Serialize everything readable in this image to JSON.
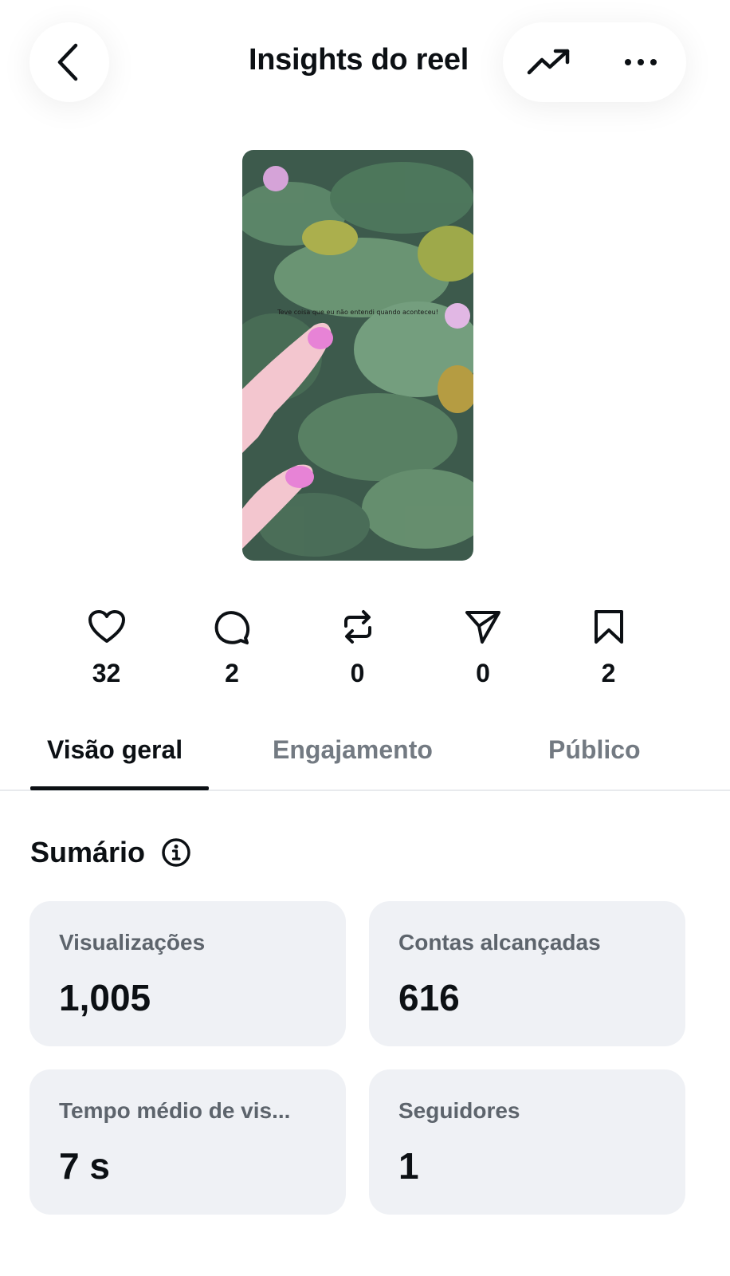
{
  "header": {
    "title": "Insights do reel",
    "back_icon": "chevron-left-icon",
    "trend_icon": "trending-up-icon",
    "more_icon": "more-horizontal-icon"
  },
  "reel": {
    "caption": "Teve coisa que eu não entendi quando aconteceu!"
  },
  "stats": [
    {
      "icon": "heart-icon",
      "value": "32"
    },
    {
      "icon": "comment-icon",
      "value": "2"
    },
    {
      "icon": "repost-icon",
      "value": "0"
    },
    {
      "icon": "share-icon",
      "value": "0"
    },
    {
      "icon": "bookmark-icon",
      "value": "2"
    }
  ],
  "tabs": [
    {
      "label": "Visão geral",
      "active": true
    },
    {
      "label": "Engajamento",
      "active": false
    },
    {
      "label": "Público",
      "active": false
    }
  ],
  "summary": {
    "title": "Sumário",
    "info_icon": "info-icon",
    "cards": [
      {
        "label": "Visualizações",
        "value": "1,005"
      },
      {
        "label": "Contas alcançadas",
        "value": "616"
      },
      {
        "label": "Tempo médio de vis...",
        "value": "7 s"
      },
      {
        "label": "Seguidores",
        "value": "1"
      }
    ]
  },
  "colors": {
    "text": "#0c1014",
    "muted_tab": "#737a82",
    "card_bg": "#eff1f5",
    "card_label": "#5d646c"
  }
}
